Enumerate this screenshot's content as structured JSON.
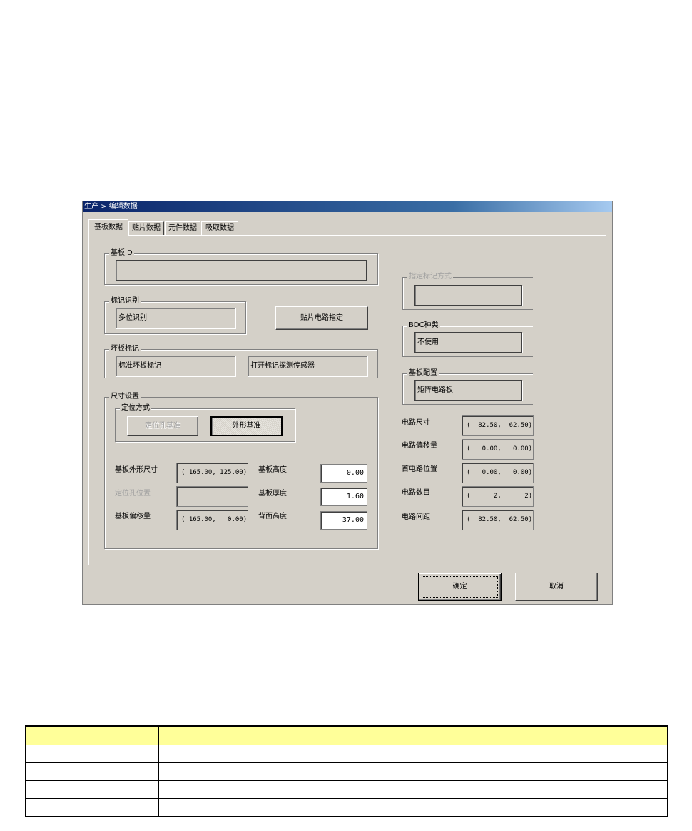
{
  "window": {
    "title": "生产 > 编辑数据"
  },
  "tabs": [
    "基板数据",
    "贴片数据",
    "元件数据",
    "吸取数据"
  ],
  "board_id": {
    "label": "基板ID",
    "value": ""
  },
  "mark_recognition": {
    "label": "标记识别",
    "value": "多位识别"
  },
  "placement_circuit_button": "贴片电路指定",
  "bad_board_mark": {
    "label": "坏板标记",
    "value1": "标准坏板标记",
    "value2": "打开标记探测传感器"
  },
  "size_settings": {
    "label": "尺寸设置",
    "positioning": {
      "label": "定位方式",
      "hole_button": "定位孔基准",
      "outline_button": "外形基准"
    },
    "outer_size": {
      "label": "基板外形尺寸",
      "value": "( 165.00, 125.00)"
    },
    "hole_position": {
      "label": "定位孔位置",
      "value": ""
    },
    "offset": {
      "label": "基板偏移量",
      "value": "( 165.00,   0.00)"
    },
    "height": {
      "label": "基板高度",
      "value": "0.00"
    },
    "thickness": {
      "label": "基板厚度",
      "value": "1.60"
    },
    "back_height": {
      "label": "背面高度",
      "value": "37.00"
    }
  },
  "designated_mark": {
    "label": "指定标记方式",
    "value": ""
  },
  "boc_type": {
    "label": "BOC种类",
    "value": "不使用"
  },
  "board_config": {
    "label": "基板配置",
    "value": "矩阵电路板"
  },
  "circuit": {
    "size": {
      "label": "电路尺寸",
      "value": "(  82.50,  62.50)"
    },
    "offset": {
      "label": "电路偏移量",
      "value": "(   0.00,   0.00)"
    },
    "first_pos": {
      "label": "首电路位置",
      "value": "(   0.00,   0.00)"
    },
    "count": {
      "label": "电路数目",
      "value": "(      2,      2)"
    },
    "pitch": {
      "label": "电路间距",
      "value": "(  82.50,  62.50)"
    }
  },
  "buttons": {
    "ok": "确定",
    "cancel": "取消"
  },
  "table": {
    "rows": 5,
    "cols": 3
  }
}
